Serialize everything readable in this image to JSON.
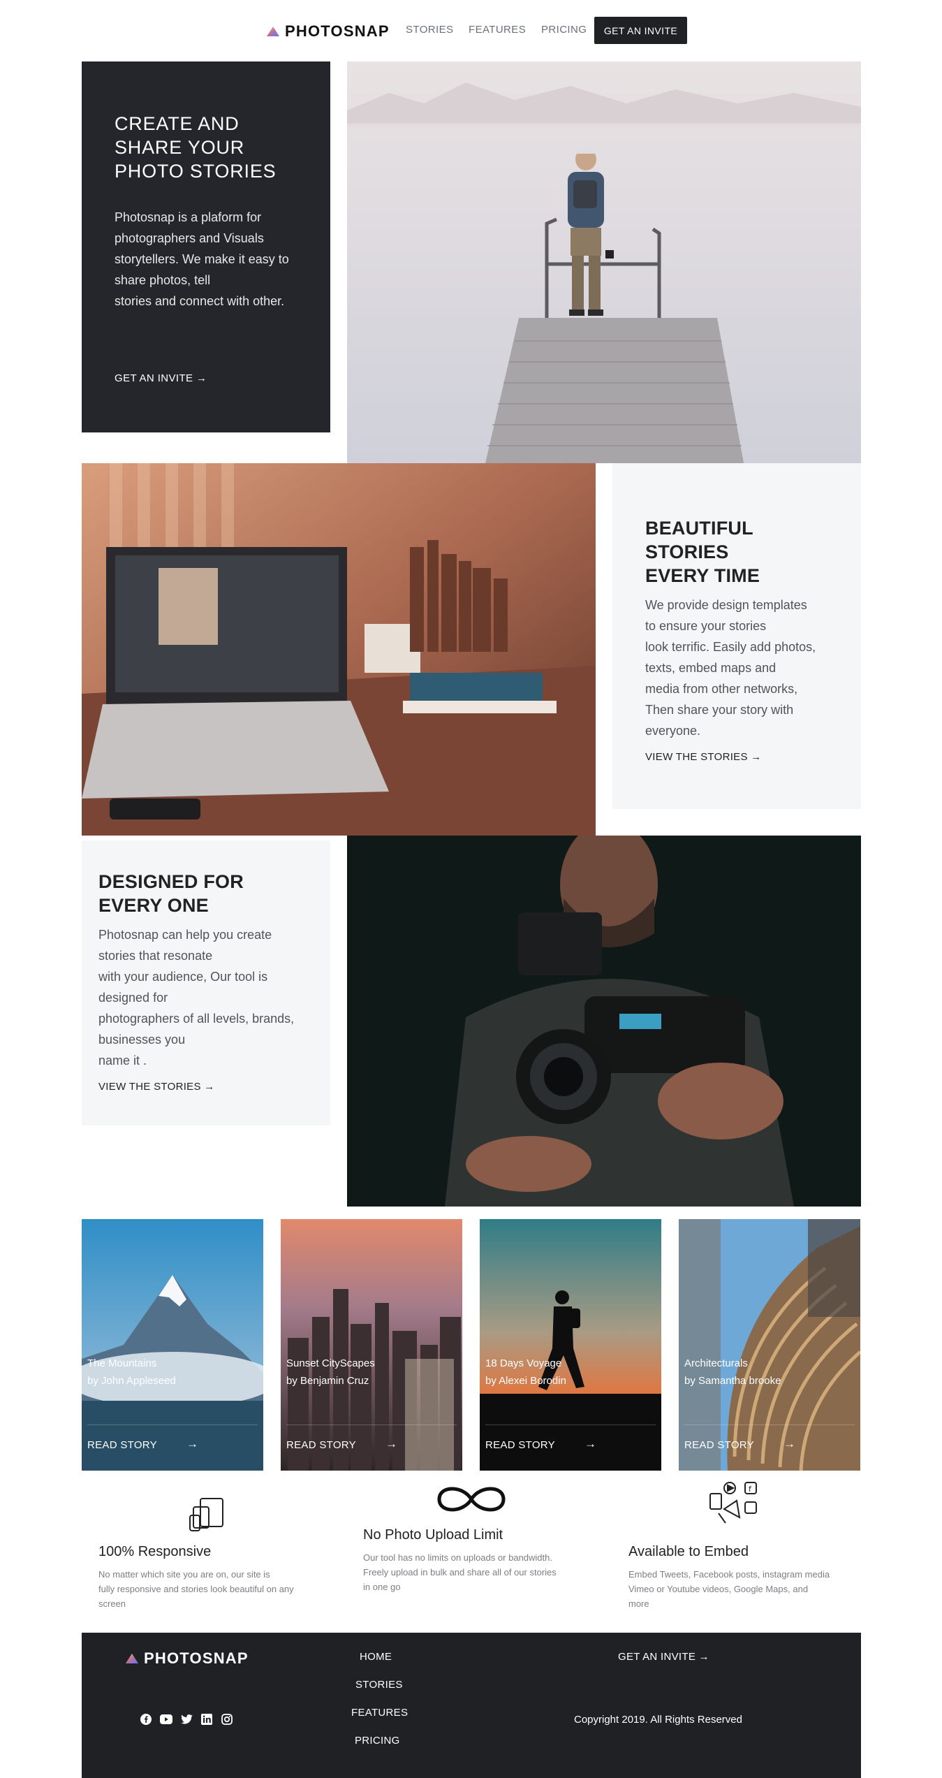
{
  "brand": {
    "name": "PHOTOSNAP"
  },
  "nav": {
    "links": [
      "STORIES",
      "FEATURES",
      "PRICING"
    ],
    "cta": "GET AN INVITE"
  },
  "hero": {
    "title": "CREATE AND\nSHARE YOUR\nPHOTO STORIES",
    "text": "Photosnap is a plaform for\nphotographers and Visuals\nstorytellers. We make it easy to\nshare photos, tell\nstories and connect with other.",
    "link": "GET AN INVITE →"
  },
  "section_beautiful": {
    "title": "BEAUTIFUL\nSTORIES\nEVERY TIME",
    "text": "We provide design templates\nto ensure your stories\nlook terrific. Easily add photos,\ntexts, embed maps and\nmedia from other networks,\nThen share your story with\neveryone.",
    "link": "VIEW THE STORIES →"
  },
  "section_designed": {
    "title": "DESIGNED FOR\nEVERY ONE",
    "text": "Photosnap can help you create\nstories that resonate\nwith your audience, Our tool is\ndesigned for\nphotographers of all levels, brands,\nbusinesses you\nname it .",
    "link": "VIEW THE STORIES →"
  },
  "stories": [
    {
      "title": "The Mountains",
      "author": "by John Appleseed",
      "read": "READ STORY"
    },
    {
      "title": "Sunset CityScapes",
      "author": "by Benjamin Cruz",
      "read": "READ STORY"
    },
    {
      "title": "18 Days Voyage",
      "author": "by Alexei Borodin",
      "read": "READ STORY"
    },
    {
      "title": "Architecturals",
      "author": "by Samantha brooke",
      "read": "READ STORY"
    }
  ],
  "features": [
    {
      "icon": "responsive-devices-icon",
      "title": "100% Responsive",
      "text": "No matter which site you are on, our site is\nfully responsive and stories look beautiful on any\nscreen"
    },
    {
      "icon": "infinity-icon",
      "title": "No Photo Upload Limit",
      "text": "Our tool has no limits on uploads or bandwidth.\nFreely upload in bulk and share all of our stories\nin one go"
    },
    {
      "icon": "embed-media-icon",
      "title": "Available to Embed",
      "text": "Embed Tweets, Facebook posts, instagram media\nVimeo or Youtube videos, Google Maps, and\nmore"
    }
  ],
  "footer": {
    "links": [
      "HOME",
      "STORIES",
      "FEATURES",
      "PRICING"
    ],
    "cta": "GET AN INVITE →",
    "copyright": "Copyright 2019. All Rights Reserved",
    "social": [
      "facebook-icon",
      "youtube-icon",
      "twitter-icon",
      "linkedin-icon",
      "instagram-icon"
    ]
  },
  "colors": {
    "dark": "#25262b",
    "light_card": "#f5f6f8",
    "footer": "#1f2125"
  }
}
